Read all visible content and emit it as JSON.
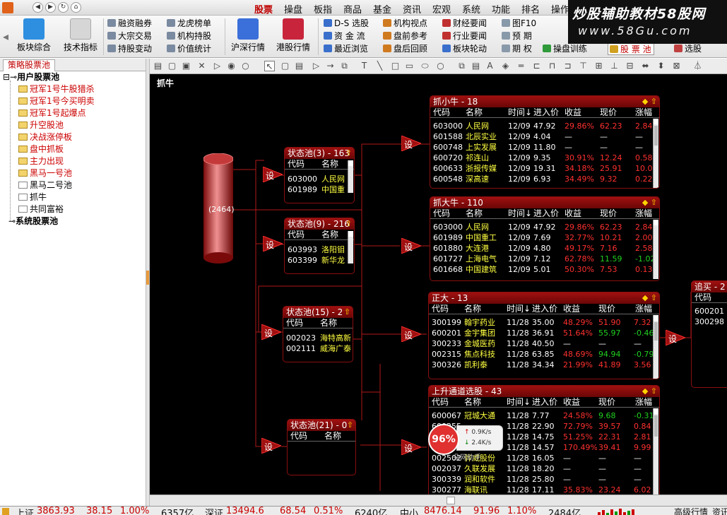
{
  "nav": {
    "back": "◀",
    "forward": "▶",
    "refresh": "↻",
    "home": "⌂"
  },
  "menu": [
    "股票",
    "操盘",
    "板指",
    "商品",
    "基金",
    "资讯",
    "宏观",
    "系统",
    "功能",
    "排名",
    "操作"
  ],
  "menu_active": 0,
  "watermark": {
    "line1": "炒股辅助教材58股网",
    "line2": "www.58Gu.com"
  },
  "toolbar": {
    "big": [
      {
        "label": "板块综合",
        "icon": "blocks-icon",
        "color": "#2e8fe0"
      },
      {
        "label": "技术指标",
        "icon": "indicator-sheet-icon",
        "color": "#d6d6d6"
      },
      {
        "label": "沪深行情",
        "icon": "market-chart-icon",
        "color": "#3b6fd9"
      },
      {
        "label": "港股行情",
        "icon": "hk-chart-icon",
        "color": "#c8253c"
      }
    ],
    "col1": [
      "融资融券",
      "大宗交易",
      "持股变动"
    ],
    "col2": [
      "龙虎榜单",
      "机构持股",
      "价值统计"
    ],
    "col3": [
      "D-S 选股",
      "资 金 流",
      "最近浏览"
    ],
    "col4": [
      "机构视点",
      "盘前参考",
      "盘后回顾"
    ],
    "col5": [
      "财经要闻",
      "行业要闻",
      "板块轮动"
    ],
    "col6": [
      "图F10",
      "预 期",
      "期 权"
    ],
    "col7": [
      "",
      "操盘训练"
    ],
    "pool_btn": "股 票 池",
    "select_btn": "选股"
  },
  "left": {
    "tab": "策略股票池",
    "tree": [
      {
        "label": "用户股票池",
        "type": "root"
      },
      {
        "label": "冠军1号牛股猎杀",
        "type": "red"
      },
      {
        "label": "冠军1号今买明卖",
        "type": "red"
      },
      {
        "label": "冠军1号起爆点",
        "type": "red"
      },
      {
        "label": "升空股池",
        "type": "red"
      },
      {
        "label": "决战涨停板",
        "type": "red"
      },
      {
        "label": "盘中抓板",
        "type": "red"
      },
      {
        "label": "主力出现",
        "type": "red"
      },
      {
        "label": "黑马一号池",
        "type": "red"
      },
      {
        "label": "黑马二号池",
        "type": "black"
      },
      {
        "label": "抓牛",
        "type": "plain"
      },
      {
        "label": "共同富裕",
        "type": "plain"
      },
      {
        "label": "系统股票池",
        "type": "root"
      }
    ]
  },
  "canvas": {
    "title": "抓牛",
    "source_count": "(2464)",
    "set_label": "设",
    "state_pools": [
      {
        "title": "状态池(3) - 163",
        "cols": [
          "代码",
          "名称"
        ],
        "rows": [
          [
            "603000",
            "人民网"
          ],
          [
            "601989",
            "中国重"
          ]
        ]
      },
      {
        "title": "状态池(9) - 216",
        "cols": [
          "代码",
          "名称"
        ],
        "rows": [
          [
            "603993",
            "洛阳钼"
          ],
          [
            "603399",
            "新华龙"
          ]
        ]
      },
      {
        "title": "状态池(15) - 2",
        "cols": [
          "代码",
          "名称"
        ],
        "rows": [
          [
            "002023",
            "海特高新"
          ],
          [
            "002111",
            "威海广泰"
          ]
        ]
      },
      {
        "title": "状态池(21) - 0",
        "cols": [
          "代码",
          "名称"
        ],
        "rows": []
      }
    ],
    "result_cols": [
      "代码",
      "名称",
      "时间↓",
      "进入价",
      "收益",
      "现价",
      "涨幅"
    ],
    "result_pools": [
      {
        "title": "抓小牛 - 18",
        "rows": [
          [
            "603000",
            "人民网",
            "12/09",
            "47.92",
            "29.86%",
            "62.23",
            "2.84"
          ],
          [
            "601588",
            "北辰实业",
            "12/09",
            "4.04",
            "—",
            "—",
            "—"
          ],
          [
            "600748",
            "上实发展",
            "12/09",
            "11.80",
            "—",
            "—",
            "—"
          ],
          [
            "600720",
            "祁连山",
            "12/09",
            "9.35",
            "30.91%",
            "12.24",
            "0.58"
          ],
          [
            "600633",
            "浙报传媒",
            "12/09",
            "19.31",
            "34.18%",
            "25.91",
            "10.0"
          ],
          [
            "600548",
            "深高速",
            "12/09",
            "6.93",
            "34.49%",
            "9.32",
            "0.22"
          ]
        ]
      },
      {
        "title": "抓大牛 - 110",
        "rows": [
          [
            "603000",
            "人民网",
            "12/09",
            "47.92",
            "29.86%",
            "62.23",
            "2.84"
          ],
          [
            "601989",
            "中国重工",
            "12/09",
            "7.69",
            "32.77%",
            "10.21",
            "2.00"
          ],
          [
            "601880",
            "大连港",
            "12/09",
            "4.80",
            "49.17%",
            "7.16",
            "2.58"
          ],
          [
            "601727",
            "上海电气",
            "12/09",
            "7.12",
            "62.78%",
            "11.59",
            "-1.02"
          ],
          [
            "601668",
            "中国建筑",
            "12/09",
            "5.01",
            "50.30%",
            "7.53",
            "0.13"
          ]
        ]
      },
      {
        "title": "正大 - 13",
        "rows": [
          [
            "300199",
            "翰宇药业",
            "11/28",
            "35.00",
            "48.29%",
            "51.90",
            "7.32"
          ],
          [
            "600201",
            "金宇集团",
            "11/28",
            "36.91",
            "51.64%",
            "55.97",
            "-0.46"
          ],
          [
            "300233",
            "金城医药",
            "11/28",
            "40.50",
            "—",
            "—",
            "—"
          ],
          [
            "002315",
            "焦点科技",
            "11/28",
            "63.85",
            "48.69%",
            "94.94",
            "-0.79"
          ],
          [
            "300326",
            "凯利泰",
            "11/28",
            "34.34",
            "21.99%",
            "41.89",
            "3.56"
          ]
        ]
      },
      {
        "title": "上升通道选股 - 43",
        "rows": [
          [
            "600067",
            "冠城大通",
            "11/28",
            "7.77",
            "24.58%",
            "9.68",
            "-0.31"
          ],
          [
            "600255",
            "",
            "11/28",
            "22.90",
            "72.79%",
            "39.57",
            "0.84"
          ],
          [
            "600868",
            "",
            "11/28",
            "14.75",
            "51.25%",
            "22.31",
            "2.81"
          ],
          [
            "002281",
            "",
            "11/28",
            "14.57",
            "170.49%",
            "39.41",
            "9.99"
          ],
          [
            "002502",
            "骅威股份",
            "11/28",
            "16.05",
            "—",
            "—",
            "—"
          ],
          [
            "002037",
            "久联发展",
            "11/28",
            "18.20",
            "—",
            "—",
            "—"
          ],
          [
            "300339",
            "润和软件",
            "11/28",
            "25.80",
            "—",
            "—",
            "—"
          ],
          [
            "300277",
            "海联讯",
            "11/28",
            "17.11",
            "35.83%",
            "23.24",
            "6.02"
          ]
        ]
      }
    ],
    "buy_pool": {
      "title": "追买 - 2",
      "cols": [
        "代码"
      ],
      "rows": [
        [
          "600201"
        ],
        [
          "300298"
        ]
      ]
    }
  },
  "net_widget": {
    "percent": "96%",
    "up": "0.9K/s",
    "down": "2.4K/s",
    "logo": "朵网助手"
  },
  "status": {
    "sh_name": "上证",
    "sh_val": "3863.93",
    "sh_chg": "38.15",
    "sh_pct": "1.00%",
    "sh_vol": "6357亿",
    "sz_name": "深证",
    "sz_val": "13494.6",
    "sz_chg": "68.54",
    "sz_pct": "0.51%",
    "sz_vol": "6240亿",
    "zx_name": "中小",
    "zx_val": "8476.14",
    "zx_chg": "91.96",
    "zx_pct": "1.10%",
    "zx_vol": "2484亿",
    "right1": "高级行情",
    "right2": "资讯"
  }
}
